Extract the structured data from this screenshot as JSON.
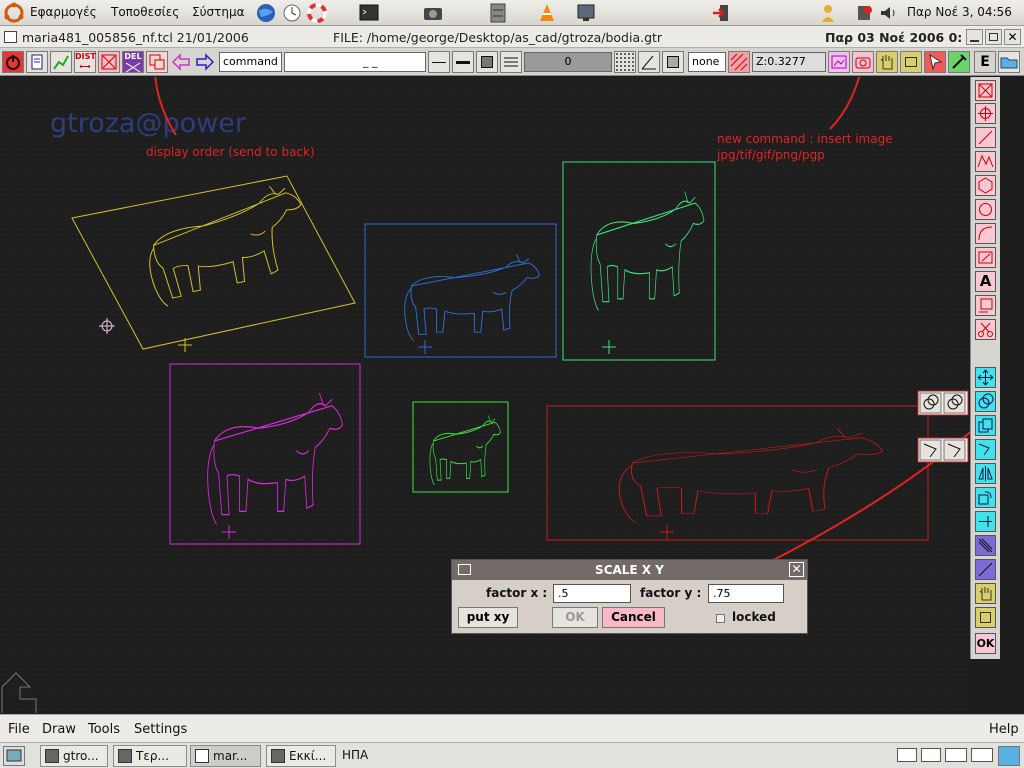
{
  "top_panel": {
    "menus": [
      "Εφαρμογές",
      "Τοποθεσίες",
      "Σύστημα"
    ],
    "clock": "Παρ Νοέ  3, 04:56"
  },
  "title_bar": {
    "left": "maria481_005856_nf.tcl 21/01/2006",
    "file": "FILE: /home/george/Desktop/as_cad/gtroza/bodia.gtr",
    "date": "Παρ 03 Νοέ 2006 0:"
  },
  "toolbar": {
    "dist_label": "DIST",
    "del_label": "DEL",
    "command_field": "command",
    "command_input": "_ _",
    "counter_value": "0",
    "linetype_value": "none",
    "zoom_readout": "Z:0.3277",
    "e_label": "E"
  },
  "canvas": {
    "watermark": "gtroza@power",
    "annotations": {
      "display_order": "display order (send to back)",
      "insert_image_1": "new command : insert image",
      "insert_image_2": "jpg/tif/gif/png/pgp"
    }
  },
  "right_toolbar": {
    "text_tool_label": "A",
    "ok_label": "OK"
  },
  "scale_dialog": {
    "title": "SCALE X Y",
    "factor_x_label": "factor x :",
    "factor_x_value": ".5",
    "factor_y_label": "factor y :",
    "factor_y_value": ".75",
    "put_xy_label": "put xy",
    "ok_label": "OK",
    "cancel_label": "Cancel",
    "locked_label": "locked"
  },
  "menu_bar": {
    "file": "File",
    "draw": "Draw",
    "tools": "Tools",
    "settings": "Settings",
    "help": "Help"
  },
  "taskbar": {
    "tasks": [
      "gtro...",
      "Τερ...",
      "mar...",
      "Εκκί..."
    ],
    "language": "ΗΠΑ"
  },
  "colors": {
    "cow_yellow": "#d4c02a",
    "cow_blue": "#2f6fd6",
    "cow_green": "#3fe07a",
    "cow_magenta": "#d82ad8",
    "cow_lime": "#3ee03e",
    "cow_red": "#c81a1a",
    "annotation": "#e02323"
  }
}
